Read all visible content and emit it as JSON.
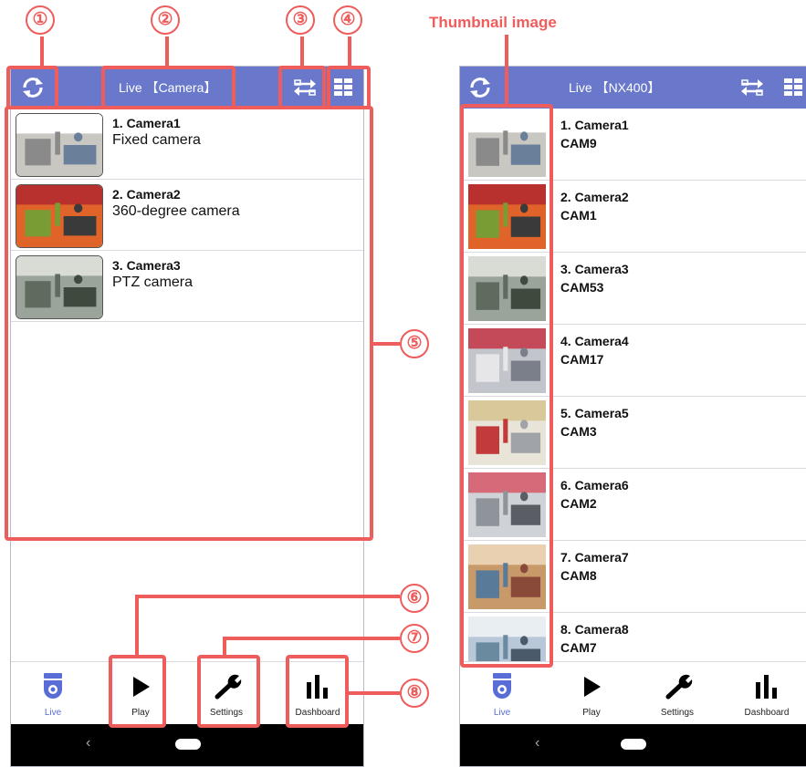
{
  "annotations": {
    "markers": [
      "①",
      "②",
      "③",
      "④",
      "⑤",
      "⑥",
      "⑦",
      "⑧"
    ],
    "thumbnail_caption": "Thumbnail image",
    "color": "#ee5c5c"
  },
  "left": {
    "title": "Live 【Camera】",
    "cameras": [
      {
        "name": "1. Camera1",
        "sub": "Fixed camera"
      },
      {
        "name": "2. Camera2",
        "sub": "360-degree camera"
      },
      {
        "name": "3. Camera3",
        "sub": "PTZ camera"
      }
    ]
  },
  "right": {
    "title": "Live 【NX400】",
    "cameras": [
      {
        "name": "1. Camera1",
        "sub": "CAM9"
      },
      {
        "name": "2. Camera2",
        "sub": "CAM1"
      },
      {
        "name": "3. Camera3",
        "sub": "CAM53"
      },
      {
        "name": "4. Camera4",
        "sub": "CAM17"
      },
      {
        "name": "5. Camera5",
        "sub": "CAM3"
      },
      {
        "name": "6. Camera6",
        "sub": "CAM2"
      },
      {
        "name": "7. Camera7",
        "sub": "CAM8"
      },
      {
        "name": "8. Camera8",
        "sub": "CAM7"
      }
    ]
  },
  "nav": {
    "live": "Live",
    "play": "Play",
    "settings": "Settings",
    "dashboard": "Dashboard"
  },
  "icons": {
    "refresh": "refresh-icon",
    "switch": "switch-view-icon",
    "grid": "grid-icon",
    "live": "camera-dome-icon",
    "play": "play-icon",
    "settings": "wrench-icon",
    "dashboard": "bar-chart-icon",
    "back": "back-chevron-icon",
    "home": "home-pill-icon"
  },
  "colors": {
    "topbar": "#6a78cc",
    "active_nav": "#5a6cd6"
  }
}
